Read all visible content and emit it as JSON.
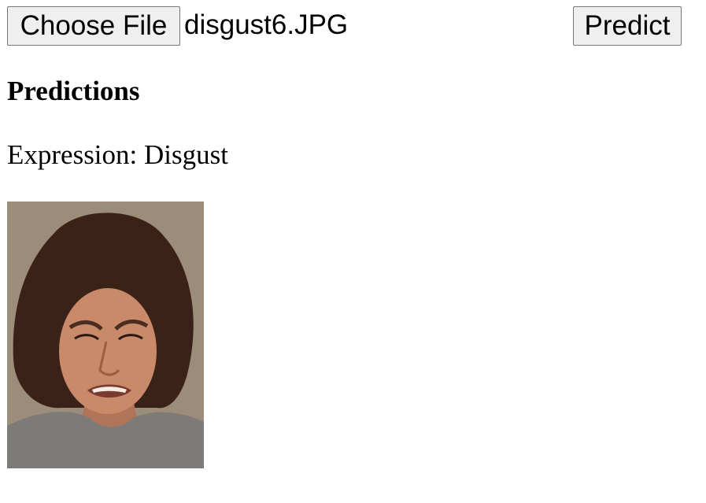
{
  "toolbar": {
    "choose_file_label": "Choose File",
    "file_name": "disgust6.JPG",
    "predict_label": "Predict"
  },
  "results": {
    "heading": "Predictions",
    "expression_prefix": "Expression:",
    "expression_value": "Disgust"
  },
  "image": {
    "icon": "face-photo",
    "colors": {
      "background": "#9a8b78",
      "hair": "#3a2218",
      "skin": "#c88a68",
      "shirt": "#7d7b78"
    }
  }
}
